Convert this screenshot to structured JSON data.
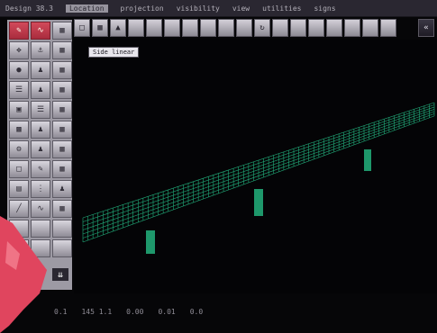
{
  "menubar": {
    "items": [
      {
        "label": "Design 38.3"
      },
      {
        "label": "Location",
        "selected": true
      },
      {
        "label": "projection"
      },
      {
        "label": "visibility"
      },
      {
        "label": "view"
      },
      {
        "label": "utilities"
      },
      {
        "label": "signs"
      }
    ]
  },
  "viewport": {
    "label": "Side linear"
  },
  "statusbar": {
    "segments": [
      "0.1",
      "145 1.1",
      "0.00",
      "0.01",
      "0.0"
    ]
  },
  "colors": {
    "menubar_bg": "#2a2731",
    "wire_green": "#27c98e",
    "palette_bg": "#9d9aa4",
    "desk_pink": "#e0455e"
  },
  "icons": {
    "scroll_down": "double-chevron-down-icon",
    "collapse": "double-chevron-left-icon"
  }
}
